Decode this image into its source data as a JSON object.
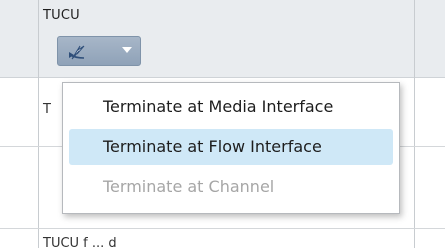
{
  "column": {
    "title": "TUCU"
  },
  "dropdown": {
    "icon": "terminate-icon",
    "caret": "chevron-down-icon"
  },
  "rows": [
    {
      "text": "T"
    },
    {
      "text": ""
    },
    {
      "text": "TUCU f ... d"
    }
  ],
  "menu": {
    "items": [
      {
        "label": "Terminate at Media Interface",
        "state": "normal"
      },
      {
        "label": "Terminate at Flow Interface",
        "state": "highlighted"
      },
      {
        "label": "Terminate at Channel",
        "state": "disabled"
      }
    ]
  },
  "colors": {
    "highlight": "#cfe8f7",
    "header_bg": "#e9ecef",
    "button": "#8fa2b8"
  }
}
